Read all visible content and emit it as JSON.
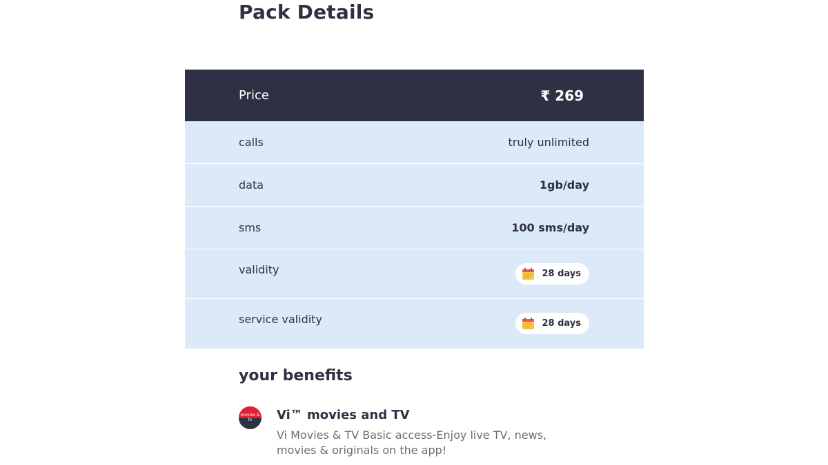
{
  "title": "Pack Details",
  "price": {
    "label": "Price",
    "value": "₹ 269"
  },
  "rows": [
    {
      "label": "calls",
      "value": "truly unlimited"
    },
    {
      "label": "data",
      "value": "1gb/day"
    },
    {
      "label": "sms",
      "value": "100 sms/day"
    },
    {
      "label": "validity",
      "value": "28 days",
      "icon": "calendar-icon"
    },
    {
      "label": "service validity",
      "value": "28 days",
      "icon": "calendar-icon"
    }
  ],
  "benefits": {
    "title": "your benefits",
    "items": [
      {
        "logo_text": "movies & tv",
        "name": "Vi™ movies and TV",
        "description": "Vi Movies & TV Basic access-Enjoy live TV, news, movies & originals on the app!"
      }
    ]
  },
  "colors": {
    "header_bg": "#303044",
    "row_bg": "#dce9f8",
    "text": "#2f3041",
    "brand_red": "#e51d32"
  }
}
